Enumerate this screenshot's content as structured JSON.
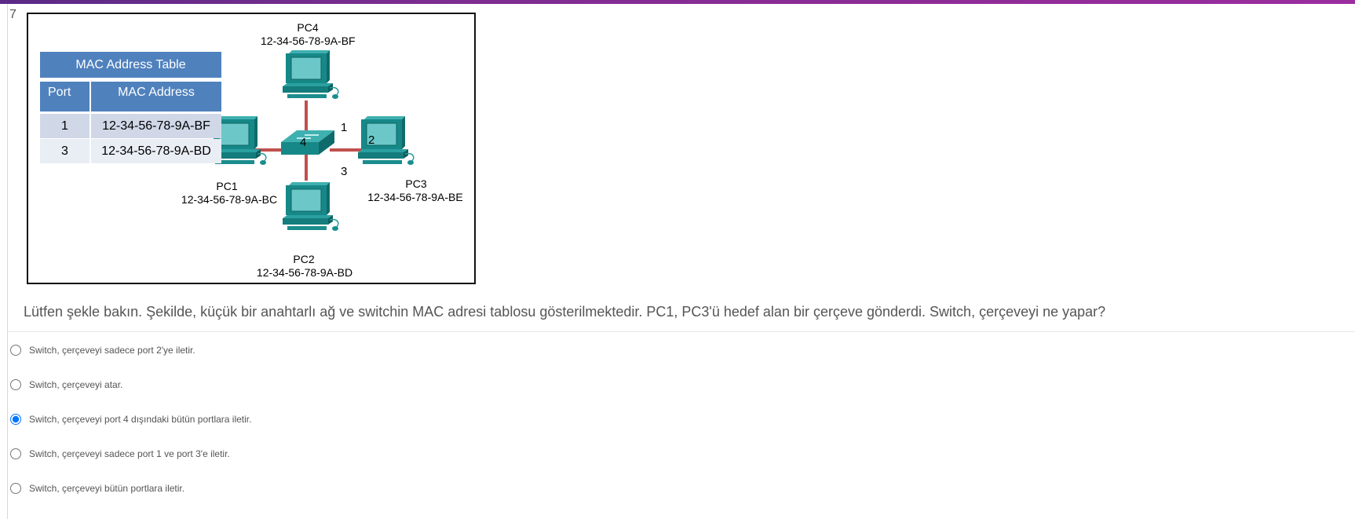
{
  "question": {
    "number": "7",
    "text": "Lütfen şekle bakın. Şekilde, küçük bir anahtarlı ağ ve switchin MAC adresi tablosu gösterilmektedir. PC1, PC3'ü hedef alan bir çerçeve gönderdi. Switch, çerçeveyi ne yapar?"
  },
  "figure": {
    "mac_table": {
      "title": "MAC Address Table",
      "headers": [
        "Port",
        "MAC Address"
      ],
      "rows": [
        {
          "port": "1",
          "mac": "12-34-56-78-9A-BF"
        },
        {
          "port": "3",
          "mac": "12-34-56-78-9A-BD"
        }
      ]
    },
    "pcs": {
      "pc4": {
        "name": "PC4",
        "mac": "12-34-56-78-9A-BF"
      },
      "pc1": {
        "name": "PC1",
        "mac": "12-34-56-78-9A-BC"
      },
      "pc3": {
        "name": "PC3",
        "mac": "12-34-56-78-9A-BE"
      },
      "pc2": {
        "name": "PC2",
        "mac": "12-34-56-78-9A-BD"
      }
    },
    "ports": {
      "p1": "1",
      "p2": "2",
      "p3": "3",
      "p4": "4"
    },
    "colors": {
      "device": "#1a8a8a",
      "link": "#c0504d",
      "table_header": "#4f81bd"
    }
  },
  "options": [
    {
      "label": "Switch, çerçeveyi sadece port 2'ye iletir.",
      "selected": false
    },
    {
      "label": "Switch, çerçeveyi atar.",
      "selected": false
    },
    {
      "label": "Switch, çerçeveyi port 4 dışındaki bütün portlara iletir.",
      "selected": true
    },
    {
      "label": "Switch, çerçeveyi sadece port 1 ve port 3'e iletir.",
      "selected": false
    },
    {
      "label": "Switch, çerçeveyi bütün portlara iletir.",
      "selected": false
    }
  ]
}
